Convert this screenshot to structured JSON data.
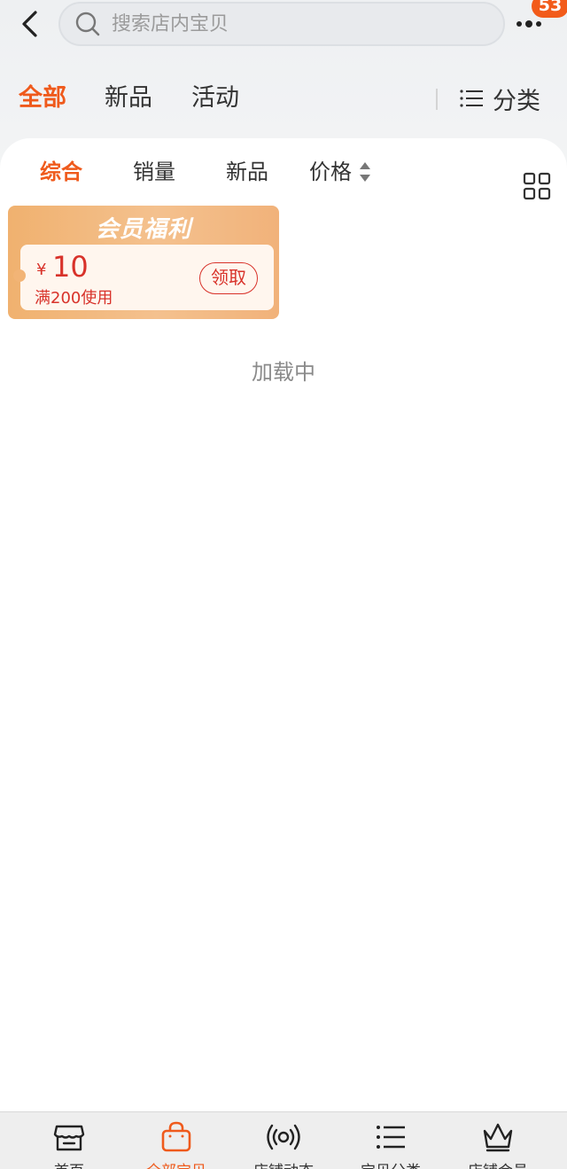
{
  "header": {
    "search_placeholder": "搜索店内宝贝",
    "badge_count": "53"
  },
  "top_tabs": [
    {
      "label": "全部",
      "active": true
    },
    {
      "label": "新品",
      "active": false
    },
    {
      "label": "活动",
      "active": false
    }
  ],
  "category_label": "分类",
  "sort_bar": [
    {
      "label": "综合",
      "active": true
    },
    {
      "label": "销量",
      "active": false
    },
    {
      "label": "新品",
      "active": false
    },
    {
      "label": "价格",
      "active": false
    }
  ],
  "coupon": {
    "title": "会员福利",
    "currency": "¥",
    "amount": "10",
    "condition": "满200使用",
    "claim_label": "领取"
  },
  "loading_text": "加载中",
  "bottom_nav": [
    {
      "label": "首页",
      "icon": "store-icon",
      "active": false
    },
    {
      "label": "全部宝贝",
      "icon": "shopping-bag-icon",
      "active": true
    },
    {
      "label": "店铺动态",
      "icon": "broadcast-icon",
      "active": false
    },
    {
      "label": "宝贝分类",
      "icon": "list-icon",
      "active": false
    },
    {
      "label": "店铺会员",
      "icon": "crown-icon",
      "active": false
    }
  ],
  "colors": {
    "accent": "#ef5a1c",
    "coupon_red": "#d8322a",
    "coupon_bg": "#f0b16f"
  }
}
